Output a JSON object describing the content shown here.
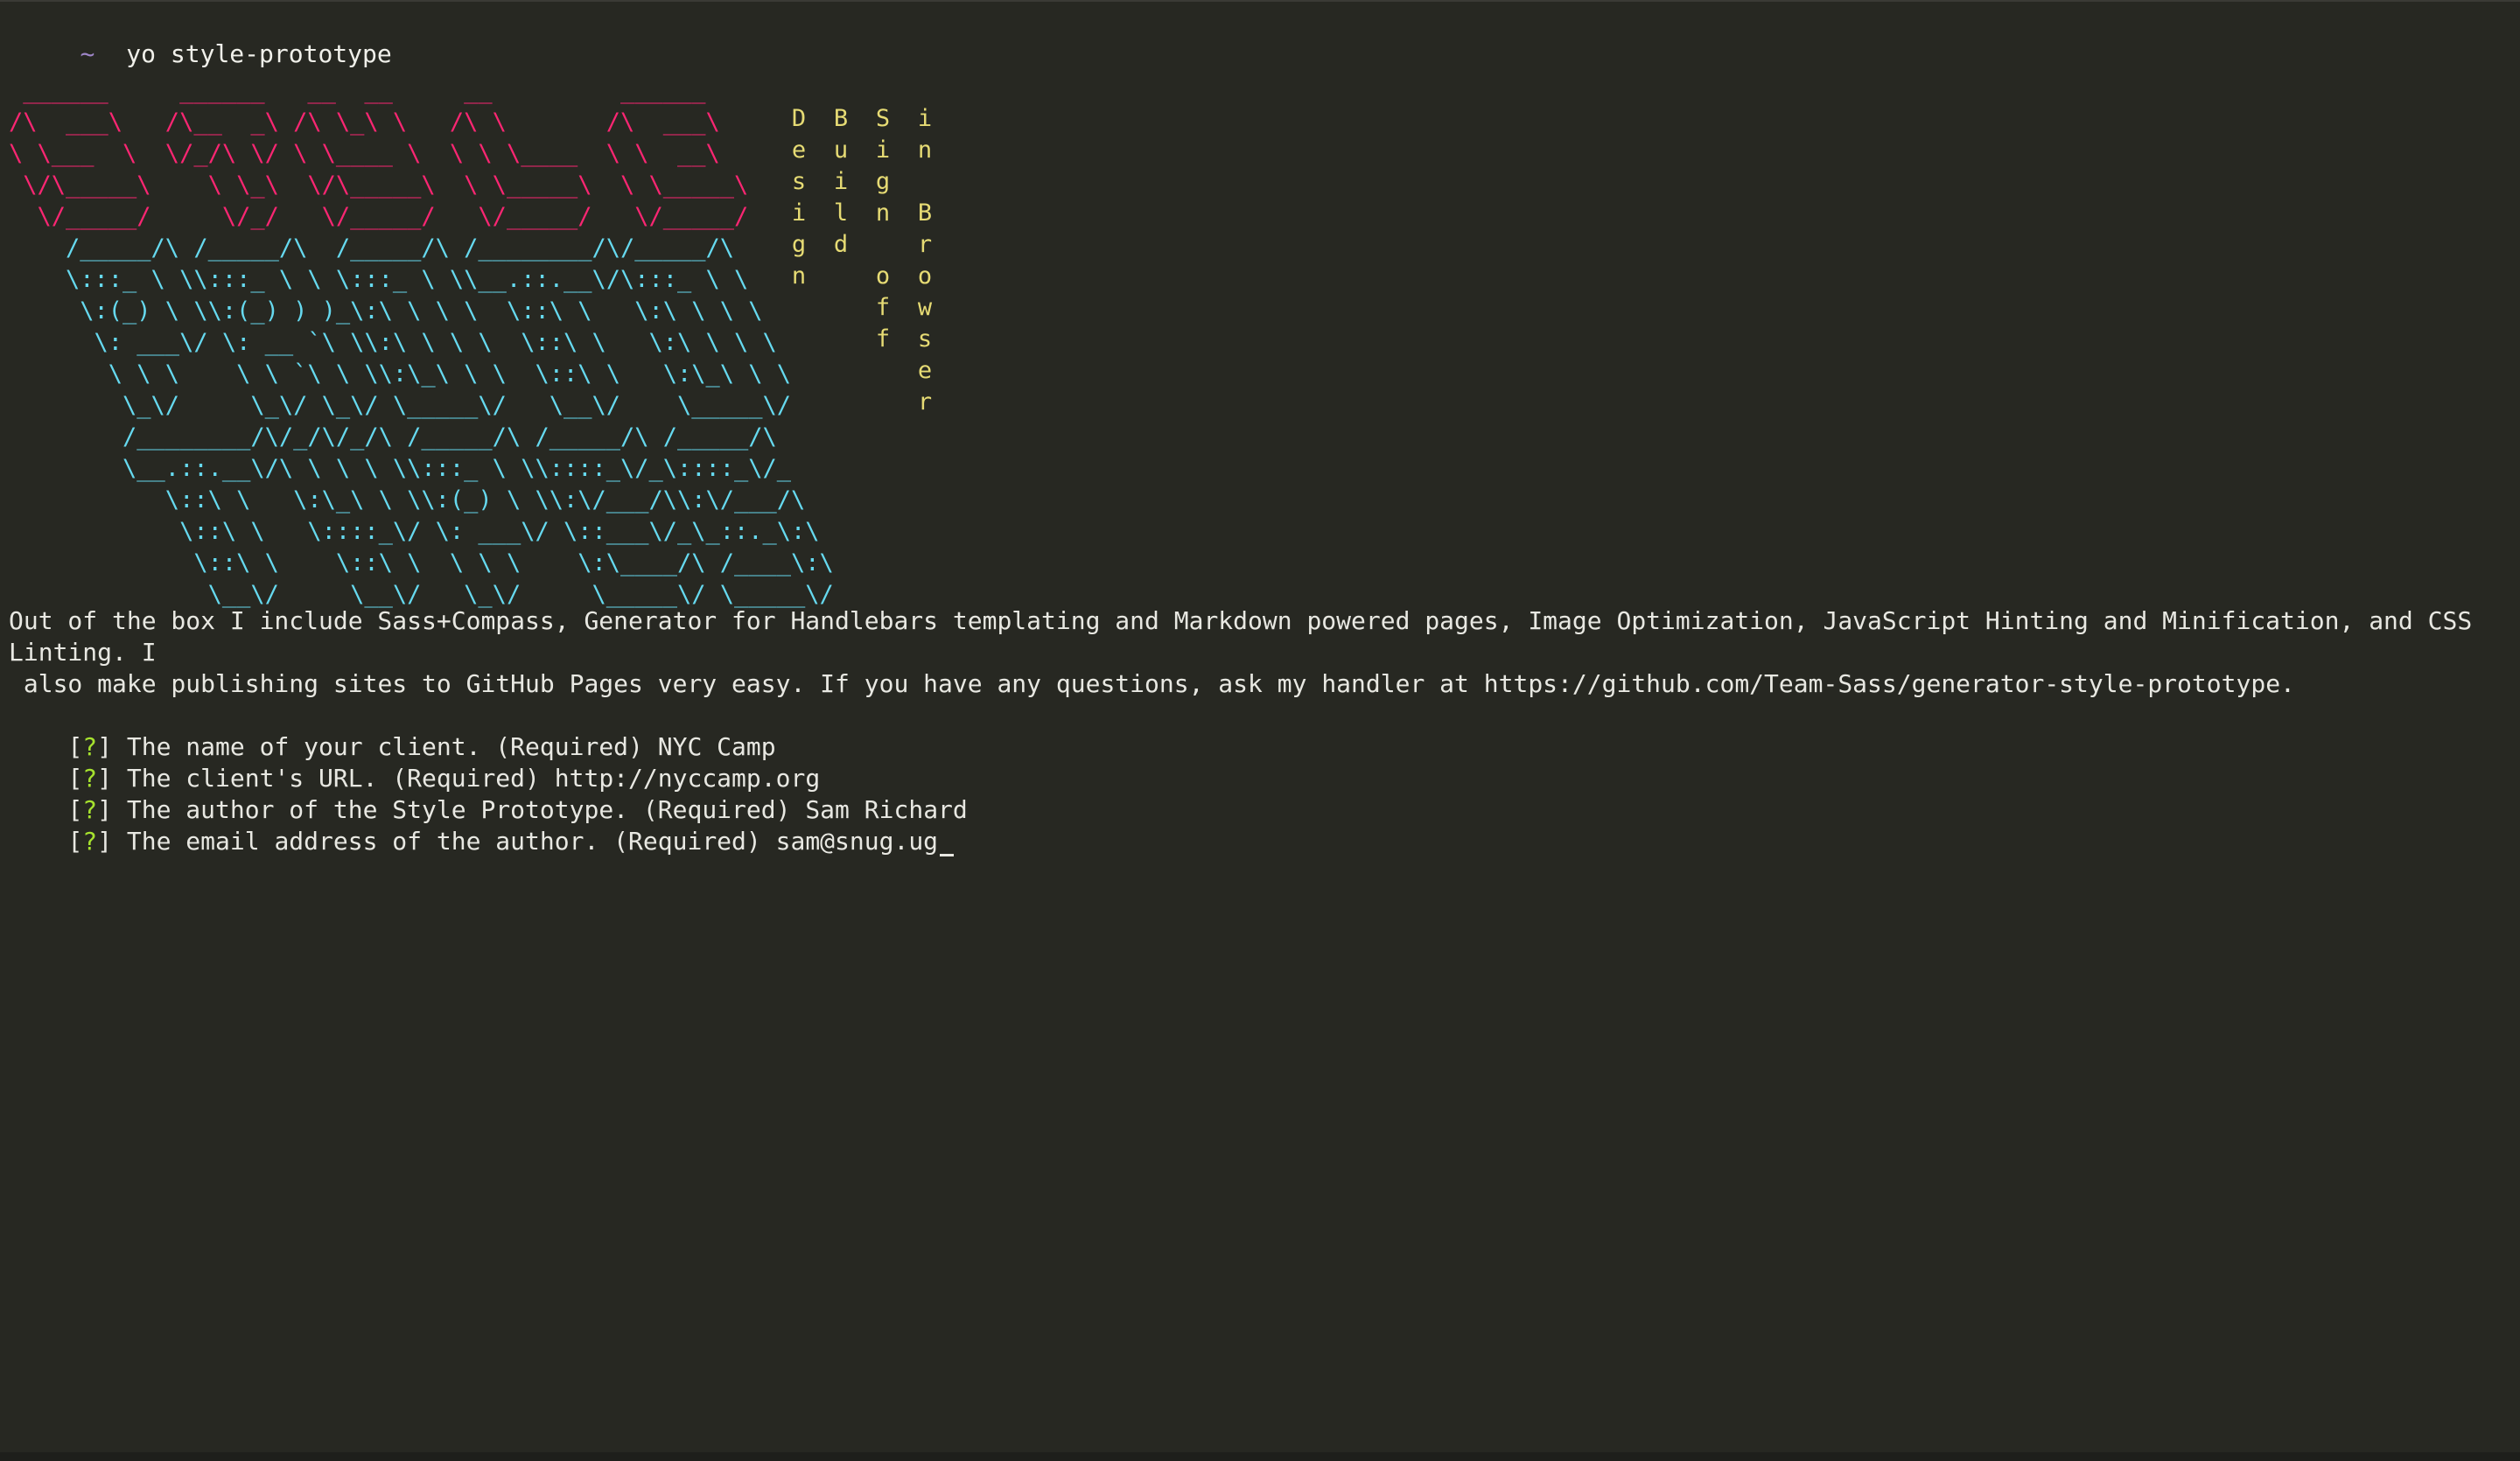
{
  "prompt": {
    "tilde": "~",
    "command": "yo style-prototype"
  },
  "colors": {
    "background": "#272822",
    "art_red": "#f92672",
    "art_cyan": "#66d9ef",
    "tagline_yellow": "#e6db74",
    "question_green": "#a6e22e"
  },
  "logo": {
    "red_art": " ______     ______   __  __     __         ______    \n/\\  ___\\   /\\__  _\\ /\\ \\_\\ \\   /\\ \\       /\\  ___\\   \n\\ \\___  \\  \\/_/\\ \\/ \\ \\____ \\  \\ \\ \\____  \\ \\  __\\   \n \\/\\_____\\    \\ \\_\\  \\/\\_____\\  \\ \\_____\\  \\ \\_____\\ \n  \\/_____/     \\/_/   \\/_____/   \\/_____/   \\/_____/ ",
    "cyan_art": "    /_____/\\ /_____/\\  /_____/\\ /________/\\/_____/\\     \n    \\:::_ \\ \\\\:::_ \\ \\ \\:::_ \\ \\\\__.::.__\\/\\:::_ \\ \\    \n     \\:(_) \\ \\\\:(_) ) )_\\:\\ \\ \\ \\  \\::\\ \\   \\:\\ \\ \\ \\   \n      \\: ___\\/ \\: __ `\\ \\\\:\\ \\ \\ \\  \\::\\ \\   \\:\\ \\ \\ \\  \n       \\ \\ \\    \\ \\ `\\ \\ \\\\:\\_\\ \\ \\  \\::\\ \\   \\:\\_\\ \\ \\ \n        \\_\\/     \\_\\/ \\_\\/ \\_____\\/   \\__\\/    \\_____\\/ \n        /________/\\/_/\\/_/\\ /_____/\\ /_____/\\ /_____/\\  \n        \\__.::.__\\/\\ \\ \\ \\ \\\\:::_ \\ \\\\::::_\\/_\\::::_\\/_ \n           \\::\\ \\   \\:\\_\\ \\ \\\\:(_) \\ \\\\:\\/___/\\\\:\\/___/\\\n            \\::\\ \\   \\::::_\\/ \\: ___\\/ \\::___\\/_\\_::._\\:\\\n             \\::\\ \\    \\::\\ \\  \\ \\ \\    \\:\\____/\\ /____\\:\\\n              \\__\\/     \\__\\/   \\_\\/     \\_____\\/ \\_____\\/"
  },
  "tagline": {
    "columns": [
      {
        "text": "Design"
      },
      {
        "text": "Build"
      },
      {
        "text": "Sign off"
      },
      {
        "text": "in Browser"
      }
    ]
  },
  "intro": {
    "text": "Out of the box I include Sass+Compass, Generator for Handlebars templating and Markdown powered pages, Image Optimization, JavaScript Hinting and Minification, and CSS Linting. I\n also make publishing sites to GitHub Pages very easy. If you have any questions, ask my handler at https://github.com/Team-Sass/generator-style-prototype."
  },
  "questions": [
    {
      "marker": "?",
      "prompt": "The name of your client. (Required)",
      "answer": "NYC Camp"
    },
    {
      "marker": "?",
      "prompt": "The client's URL. (Required)",
      "answer": "http://nyccamp.org"
    },
    {
      "marker": "?",
      "prompt": "The author of the Style Prototype. (Required)",
      "answer": "Sam Richard"
    },
    {
      "marker": "?",
      "prompt": "The email address of the author. (Required)",
      "answer": "sam@snug.ug"
    }
  ]
}
